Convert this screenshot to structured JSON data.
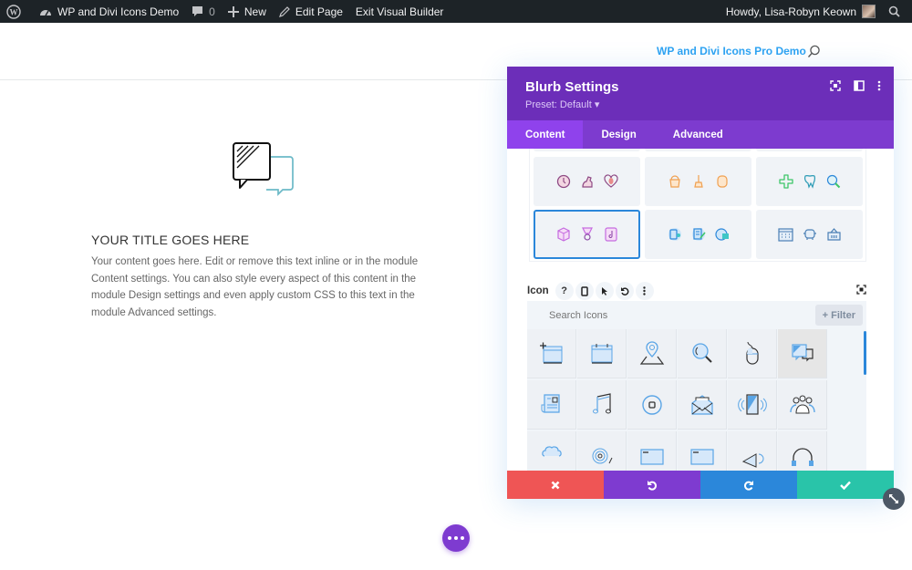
{
  "admin_bar": {
    "site_name": "WP and Divi Icons Demo",
    "comments_count": "0",
    "new_label": "New",
    "edit_page_label": "Edit Page",
    "exit_builder_label": "Exit Visual Builder",
    "greeting": "Howdy, Lisa-Robyn Keown"
  },
  "header": {
    "site_link": "WP and Divi Icons Pro Demo"
  },
  "blurb": {
    "title": "YOUR TITLE GOES HERE",
    "body": "Your content goes here. Edit or remove this text inline or in the module Content settings. You can also style every aspect of this content in the module Design settings and even apply custom CSS to this text in the module Advanced settings."
  },
  "modal": {
    "title": "Blurb Settings",
    "preset": "Preset: Default ▾",
    "tabs": [
      {
        "label": "Content",
        "active": true
      },
      {
        "label": "Design",
        "active": false
      },
      {
        "label": "Advanced",
        "active": false
      }
    ],
    "icon_presets": [
      {
        "name": "purple-lifestyle",
        "color": "#8e4a84"
      },
      {
        "name": "orange-cleaning",
        "color": "#f0a050"
      },
      {
        "name": "green-blue-dental",
        "color": "#3fc66a"
      },
      {
        "name": "pink-purple-objects",
        "color": "#c56be0",
        "selected": true
      },
      {
        "name": "blue-devices",
        "color": "#2b87da"
      },
      {
        "name": "steel-blue-business",
        "color": "#4a7fb5"
      }
    ],
    "icon_label": "Icon",
    "search_placeholder": "Search Icons",
    "filter_label": "+ Filter",
    "icons": [
      "calendar-add-icon",
      "calendar-icon",
      "map-pin-icon",
      "magnifier-icon",
      "mouse-icon",
      "chat-bubbles-icon",
      "newspaper-icon",
      "music-note-icon",
      "stop-button-icon",
      "open-envelope-icon",
      "tablet-vibrate-icon",
      "group-users-icon",
      "brain-icon",
      "fingerprint-icon",
      "browser-window-icon",
      "browser-window-alt-icon",
      "megaphone-icon",
      "headphones-icon"
    ],
    "highlighted_icon_index": 5
  },
  "colors": {
    "purple_header": "#6c2eb9",
    "tab_bar": "#7d3bcf",
    "cancel": "#ef5555",
    "undo": "#7e3bd0",
    "redo": "#2b87da",
    "save": "#29c4a9"
  }
}
